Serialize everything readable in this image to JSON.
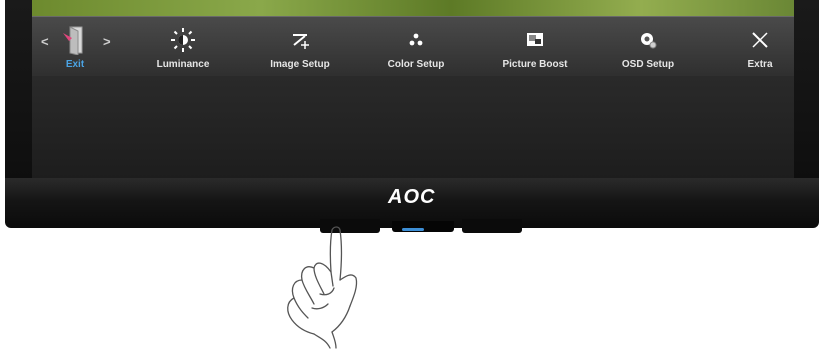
{
  "brand": {
    "logo_text": "AOC"
  },
  "osd_menu": {
    "nav_left": "<",
    "nav_right": ">",
    "items": [
      {
        "label": "Exit",
        "icon": "exit-door-icon",
        "selected": true
      },
      {
        "label": "Luminance",
        "icon": "brightness-sun-icon"
      },
      {
        "label": "Image Setup",
        "icon": "image-setup-icon"
      },
      {
        "label": "Color Setup",
        "icon": "color-dots-icon"
      },
      {
        "label": "Picture Boost",
        "icon": "picture-boost-icon"
      },
      {
        "label": "OSD Setup",
        "icon": "osd-gear-icon"
      },
      {
        "label": "Extra",
        "icon": "extra-tools-icon"
      }
    ]
  },
  "colors": {
    "selected_label": "#4ba3e3",
    "exit_icon_accent": "#e0467c",
    "power_led": "#3d8fd6"
  }
}
